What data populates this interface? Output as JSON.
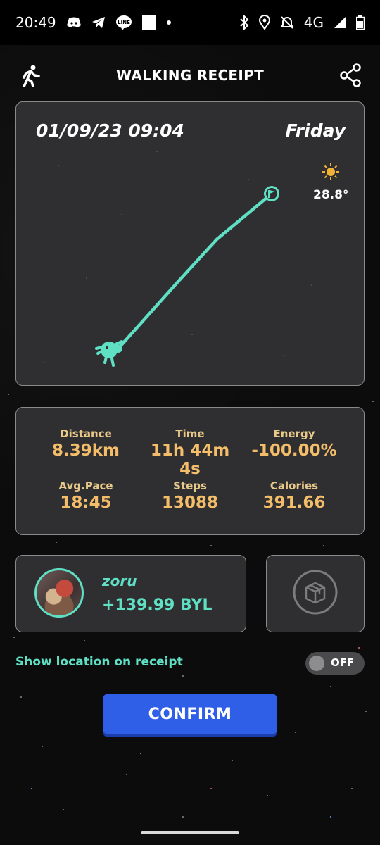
{
  "status_bar": {
    "time": "20:49",
    "network": "4G",
    "left_icons": [
      "discord-icon",
      "telegram-icon",
      "line-icon",
      "white-square-icon",
      "dot-icon"
    ],
    "right_icons": [
      "bluetooth-icon",
      "location-icon",
      "mute-icon",
      "signal-icon",
      "battery-icon"
    ]
  },
  "header": {
    "title": "WALKING RECEIPT",
    "left_icon": "walking-person-icon",
    "right_icon": "share-icon"
  },
  "map": {
    "datetime": "01/09/23 09:04",
    "day": "Friday",
    "weather_icon": "sun-icon",
    "temperature": "28.8°",
    "route_color": "#5fe0c4"
  },
  "stats": [
    {
      "label": "Distance",
      "value": "8.39km"
    },
    {
      "label": "Time",
      "value": "11h 44m 4s"
    },
    {
      "label": "Energy",
      "value": "-100.00%"
    },
    {
      "label": "Avg.Pace",
      "value": "18:45"
    },
    {
      "label": "Steps",
      "value": "13088"
    },
    {
      "label": "Calories",
      "value": "391.66"
    }
  ],
  "user": {
    "name": "zoru",
    "earned": "+139.99 BYL"
  },
  "box": {
    "icon": "box-icon"
  },
  "location_toggle": {
    "label": "Show location on receipt",
    "state": "OFF"
  },
  "confirm": {
    "label": "CONFIRM"
  },
  "colors": {
    "accent": "#5fe0c4",
    "stat_value": "#f3bd6a",
    "button": "#2f5fe6",
    "card_bg": "#2f2f31"
  }
}
